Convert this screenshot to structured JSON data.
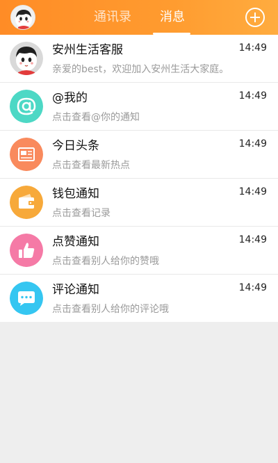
{
  "header": {
    "tabs": [
      {
        "label": "通讯录",
        "active": false
      },
      {
        "label": "消息",
        "active": true
      }
    ],
    "add_icon": "plus-circle-icon",
    "avatar_icon": "user-avatar-icon"
  },
  "messages": [
    {
      "title": "安州生活客服",
      "subtitle": "亲爱的best，欢迎加入安州生活大家庭。",
      "time": "14:49",
      "icon": "service-avatar-icon",
      "color": "#d8d8d8"
    },
    {
      "title": "@我的",
      "subtitle": "点击查看@你的通知",
      "time": "14:49",
      "icon": "at-icon",
      "color": "#4dd8c5"
    },
    {
      "title": "今日头条",
      "subtitle": "点击查看最新热点",
      "time": "14:49",
      "icon": "news-icon",
      "color": "#f98a5d"
    },
    {
      "title": "钱包通知",
      "subtitle": "点击查看记录",
      "time": "14:49",
      "icon": "wallet-icon",
      "color": "#f7a93a"
    },
    {
      "title": "点赞通知",
      "subtitle": "点击查看别人给你的赞哦",
      "time": "14:49",
      "icon": "thumbs-up-icon",
      "color": "#f57aa6"
    },
    {
      "title": "评论通知",
      "subtitle": "点击查看别人给你的评论哦",
      "time": "14:49",
      "icon": "comment-icon",
      "color": "#35c6f1"
    }
  ]
}
